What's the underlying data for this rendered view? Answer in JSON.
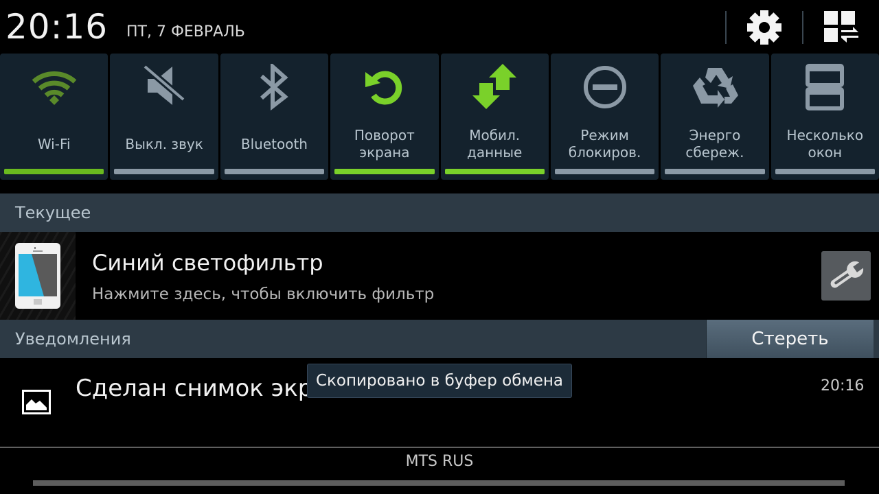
{
  "status": {
    "time": "20:16",
    "date": "ПТ, 7 ФЕВРАЛЬ"
  },
  "header_buttons": {
    "settings": "gear-icon",
    "multi_window": "grid-switch-icon"
  },
  "toggles": [
    {
      "label": "Wi-Fi",
      "icon": "wifi-icon",
      "state": "on"
    },
    {
      "label": "Выкл. звук",
      "icon": "mute-icon",
      "state": "off"
    },
    {
      "label": "Bluetooth",
      "icon": "bluetooth-icon",
      "state": "off"
    },
    {
      "label": "Поворот\nэкрана",
      "icon": "rotate-icon",
      "state": "on"
    },
    {
      "label": "Мобил.\nданные",
      "icon": "mobile-data-icon",
      "state": "on"
    },
    {
      "label": "Режим\nблокиров.",
      "icon": "block-icon",
      "state": "off"
    },
    {
      "label": "Энерго\nсбереж.",
      "icon": "recycle-icon",
      "state": "off"
    },
    {
      "label": "Несколько\nокон",
      "icon": "multi-window-icon",
      "state": "off"
    }
  ],
  "colors": {
    "active": "#7ad12a",
    "inactive": "#8b99a5",
    "tile_bg": "#14222d",
    "section_bg": "#2d3a45"
  },
  "sections": {
    "current": "Текущее",
    "notifications": "Уведомления",
    "clear_label": "Стереть"
  },
  "ongoing": {
    "title": "Синий светофильтр",
    "subtitle": "Нажмите здесь, чтобы включить фильтр"
  },
  "notification": {
    "title": "Сделан снимок экрана",
    "time": "20:16"
  },
  "toast": "Скопировано в буфер обмена",
  "carrier": "MTS RUS"
}
